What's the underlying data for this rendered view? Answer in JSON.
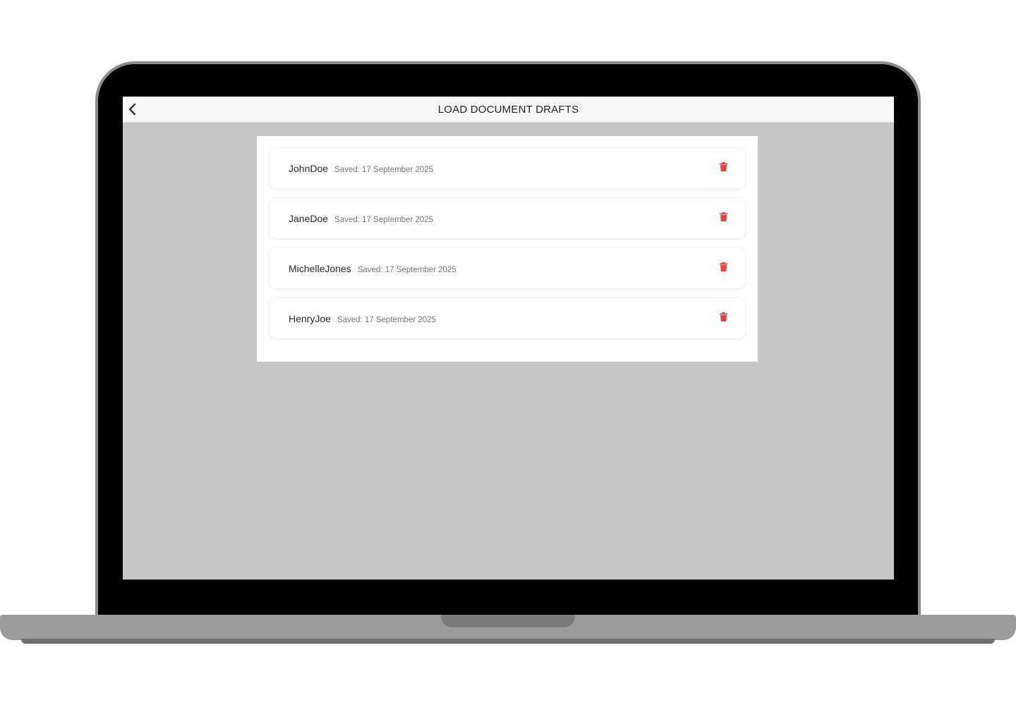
{
  "header": {
    "title": "LOAD DOCUMENT DRAFTS",
    "back_icon": "chevron-left-icon"
  },
  "drafts": [
    {
      "name": "JohnDoe",
      "saved": "Saved: 17 September 2025"
    },
    {
      "name": "JaneDoe",
      "saved": "Saved: 17 September 2025"
    },
    {
      "name": "MichelleJones",
      "saved": "Saved: 17 September 2025"
    },
    {
      "name": "HenryJoe",
      "saved": "Saved: 17 September 2025"
    }
  ],
  "icons": {
    "delete": "trash-icon"
  },
  "colors": {
    "delete": "#e8403a",
    "screen_background": "#c6c6c6",
    "header_background": "#f8f8f8"
  }
}
